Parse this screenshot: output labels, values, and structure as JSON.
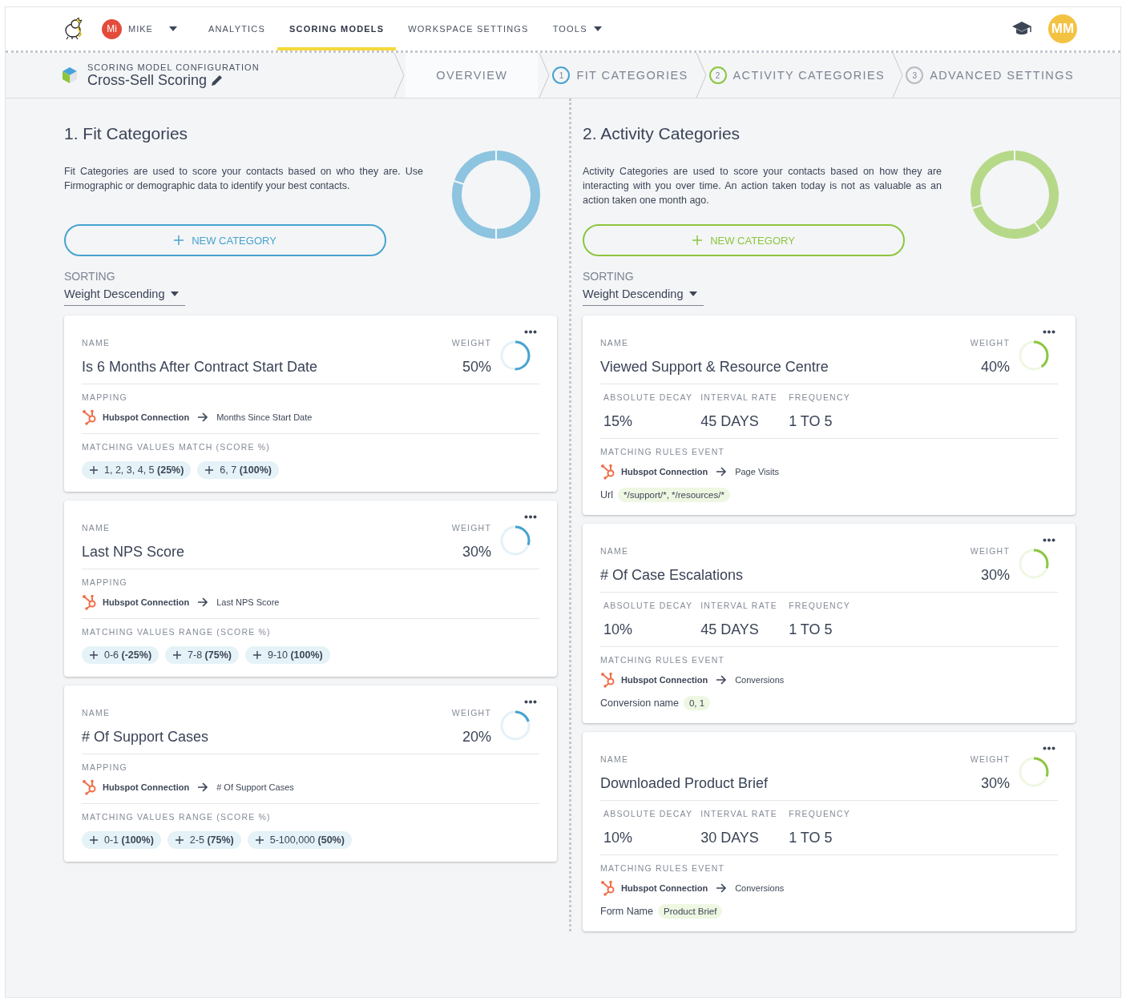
{
  "nav": {
    "user": {
      "initials": "Mi",
      "name": "MIKE"
    },
    "items": [
      {
        "label": "ANALYTICS",
        "selected": false,
        "dropdown": false
      },
      {
        "label": "SCORING MODELS",
        "selected": true,
        "dropdown": false
      },
      {
        "label": "WORKSPACE SETTINGS",
        "selected": false,
        "dropdown": false
      },
      {
        "label": "TOOLS",
        "selected": false,
        "dropdown": true
      }
    ],
    "avatar": "MM"
  },
  "model": {
    "caption": "SCORING MODEL CONFIGURATION",
    "title": "Cross-Sell Scoring"
  },
  "steps": [
    {
      "label": "OVERVIEW",
      "selected": true
    },
    {
      "number": "1",
      "label": "FIT CATEGORIES",
      "selected": false,
      "color": "#47a3d0"
    },
    {
      "number": "2",
      "label": "ACTIVITY CATEGORIES",
      "selected": false,
      "color": "#8cc63f"
    },
    {
      "number": "3",
      "label": "ADVANCED SETTINGS",
      "selected": false,
      "color": "#b8bcc2"
    }
  ],
  "sections": [
    {
      "title": "1. Fit Categories",
      "color": "#47a3d0",
      "description": "Fit Categories are used to score your contacts based on who they are. Use Firmographic or demographic data to identify your best contacts.",
      "button": "NEW CATEGORY",
      "sorting_label": "SORTING",
      "sorting": "Weight Descending",
      "categories": [
        {
          "kind": "fit",
          "name_label": "NAME",
          "name": "Is 6 Months After Contract Start Date",
          "weight_label": "WEIGHT",
          "weight": "50%",
          "level": 0.5,
          "mapping_label": "MAPPING",
          "source": "Hubspot Connection",
          "target": "Months Since Start Date",
          "values_label": "MATCHING VALUES MATCH (SCORE %)",
          "chips": [
            "1, 2, 3, 4, 5 **(25%)**",
            "6, 7 **(100%)**"
          ]
        },
        {
          "kind": "fit",
          "name_label": "NAME",
          "name": "Last NPS Score",
          "weight_label": "WEIGHT",
          "weight": "30%",
          "level": 0.3,
          "mapping_label": "MAPPING",
          "source": "Hubspot Connection",
          "target": "Last NPS Score",
          "values_label": "MATCHING VALUES RANGE (SCORE %)",
          "chips": [
            "0-6 **(-25%)**",
            "7-8 **(75%)**",
            "9-10 **(100%)**"
          ]
        },
        {
          "kind": "fit",
          "name_label": "NAME",
          "name": "# Of Support Cases",
          "weight_label": "WEIGHT",
          "weight": "20%",
          "level": 0.2,
          "mapping_label": "MAPPING",
          "source": "Hubspot Connection",
          "target": "# Of Support Cases",
          "values_label": "MATCHING VALUES RANGE (SCORE %)",
          "chips": [
            "0-1 **(100%)**",
            "2-5 **(75%)**",
            "5-100,000 **(50%)**"
          ]
        }
      ]
    },
    {
      "title": "2. Activity Categories",
      "color": "#8cc63f",
      "description": "Activity Categories are used to score your contacts based on how they are interacting with you over time. An action taken today is not as valuable as an action taken one month ago.",
      "button": "NEW CATEGORY",
      "sorting_label": "SORTING",
      "sorting": "Weight Descending",
      "categories": [
        {
          "kind": "activity",
          "name_label": "NAME",
          "name": "Viewed Support & Resource Centre",
          "weight_label": "WEIGHT",
          "weight": "40%",
          "level": 0.4,
          "stats": [
            {
              "label": "ABSOLUTE DECAY",
              "value": "15%"
            },
            {
              "label": "INTERVAL RATE",
              "value": "45 DAYS"
            },
            {
              "label": "FREQUENCY",
              "value": "1 TO 5"
            }
          ],
          "event_label": "MATCHING RULES EVENT",
          "source": "Hubspot Connection",
          "target": "Page Visits",
          "filter_label": "Url",
          "filter_value": "*/support/*, */resources/*"
        },
        {
          "kind": "activity",
          "name_label": "NAME",
          "name": "# Of Case Escalations",
          "weight_label": "WEIGHT",
          "weight": "30%",
          "level": 0.3,
          "stats": [
            {
              "label": "ABSOLUTE DECAY",
              "value": "10%"
            },
            {
              "label": "INTERVAL RATE",
              "value": "45 DAYS"
            },
            {
              "label": "FREQUENCY",
              "value": "1 TO 5"
            }
          ],
          "event_label": "MATCHING RULES EVENT",
          "source": "Hubspot Connection",
          "target": "Conversions",
          "filter_label": "Conversion name",
          "filter_value": "0, 1"
        },
        {
          "kind": "activity",
          "name_label": "NAME",
          "name": "Downloaded Product Brief",
          "weight_label": "WEIGHT",
          "weight": "30%",
          "level": 0.3,
          "stats": [
            {
              "label": "ABSOLUTE DECAY",
              "value": "10%"
            },
            {
              "label": "INTERVAL RATE",
              "value": "30 DAYS"
            },
            {
              "label": "FREQUENCY",
              "value": "1 TO 5"
            }
          ],
          "event_label": "MATCHING RULES EVENT",
          "source": "Hubspot Connection",
          "target": "Conversions",
          "filter_label": "Form Name",
          "filter_value": "Product Brief"
        }
      ]
    }
  ]
}
